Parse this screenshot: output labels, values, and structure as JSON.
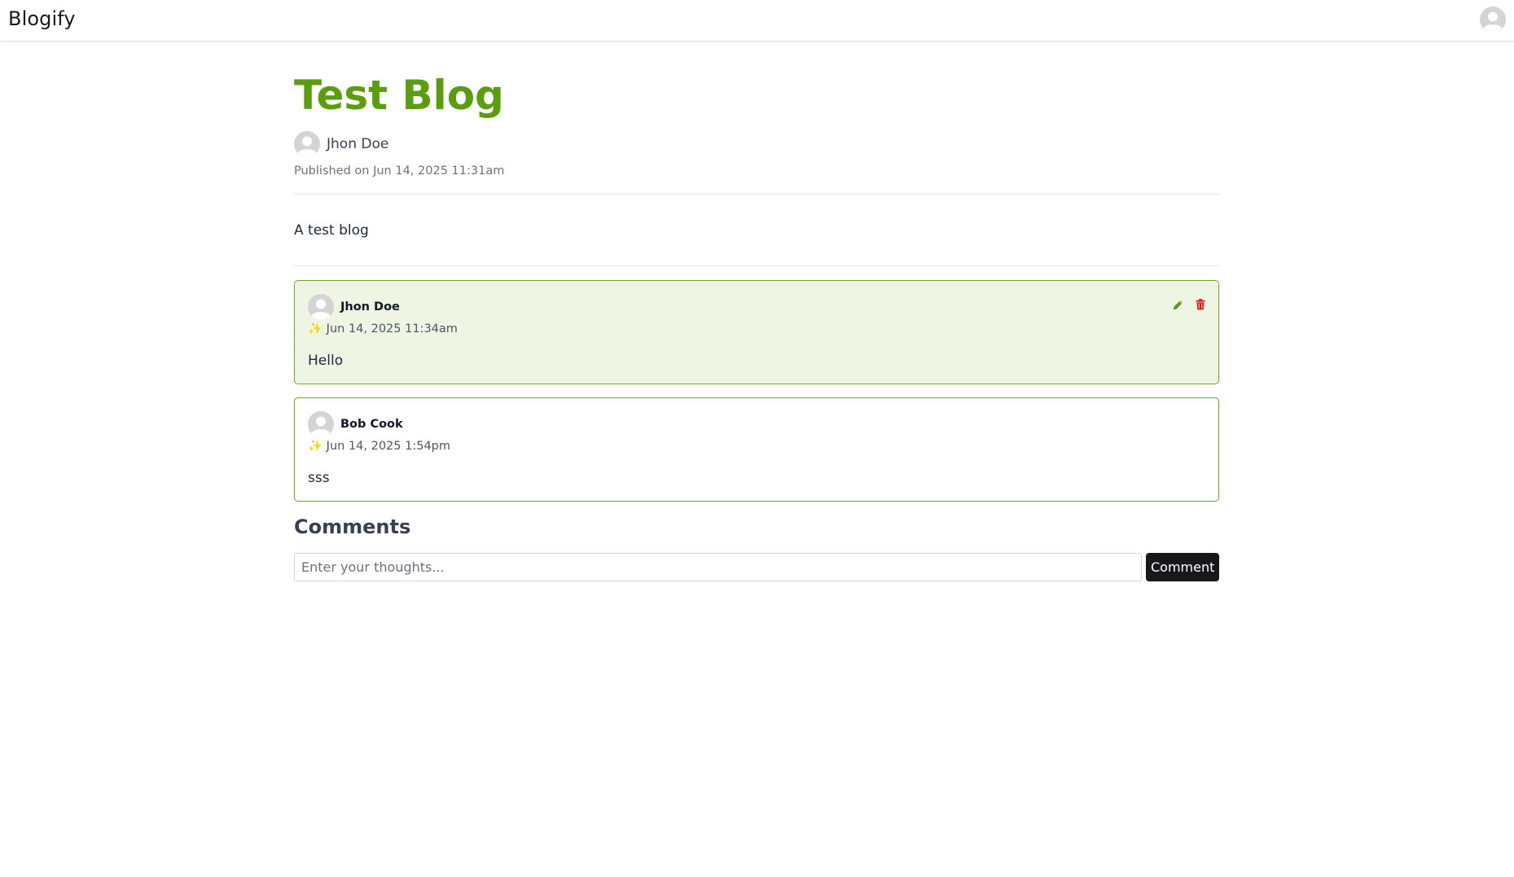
{
  "navbar": {
    "brand": "Blogify",
    "avatar_icon": "user-avatar-icon"
  },
  "post": {
    "title": "Test Blog",
    "author": "Jhon Doe",
    "published": "Published on Jun 14, 2025 11:31am",
    "body": "A test blog"
  },
  "comments": [
    {
      "author": "Jhon Doe",
      "date": "✨ Jun 14, 2025 11:34am",
      "text": "Hello",
      "own": true,
      "actions": [
        "pencil-icon",
        "trash-icon"
      ]
    },
    {
      "author": "Bob Cook",
      "date": "✨ Jun 14, 2025 1:54pm",
      "text": "sss",
      "own": false
    }
  ],
  "comment_form": {
    "heading": "Comments",
    "placeholder": "Enter your thoughts...",
    "value": "",
    "button_label": "Comment"
  },
  "colors": {
    "title_green": "#5a9e0f",
    "card_border": "#67a81c",
    "own_card_bg": "#eef5e3",
    "edit_icon": "#4d9a0c",
    "delete_icon": "#dc1c1c",
    "button_bg": "#18181b"
  }
}
